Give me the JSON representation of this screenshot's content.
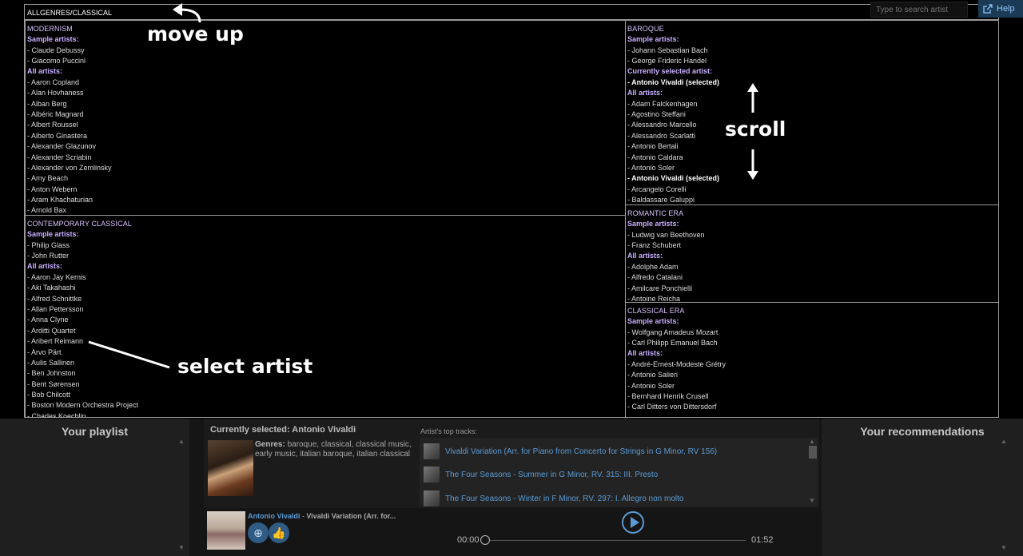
{
  "breadcrumb": "ALLGENRES/CLASSICAL",
  "search": {
    "placeholder": "Type to search artist"
  },
  "help_label": "Help",
  "annotations": {
    "move_up": "move up",
    "scroll": "scroll",
    "select_artist": "select artist"
  },
  "genres": {
    "modernism": {
      "title": "MODERNISM",
      "sample_label": "Sample artists:",
      "sample": [
        "- Claude Debussy",
        "- Giacomo Puccini"
      ],
      "all_label": "All artists:",
      "all": [
        "- Aaron Copland",
        "- Alan Hovhaness",
        "- Alban Berg",
        "- Albéric Magnard",
        "- Albert Roussel",
        "- Alberto Ginastera",
        "- Alexander Glazunov",
        "- Alexander Scriabin",
        "- Alexander von Zemlinsky",
        "- Amy Beach",
        "- Anton Webern",
        "- Aram Khachaturian",
        "- Arnold Bax"
      ]
    },
    "contemporary": {
      "title": "CONTEMPORARY CLASSICAL",
      "sample_label": "Sample artists:",
      "sample": [
        "- Philip Glass",
        "- John Rutter"
      ],
      "all_label": "All artists:",
      "all": [
        "- Aaron Jay Kernis",
        "- Aki Takahashi",
        "- Alfred Schnittke",
        "- Allan Pettersson",
        "- Anna Clyne",
        "- Arditti Quartet",
        "- Aribert Reimann",
        "- Arvo Pärt",
        "- Aulis Sallinen",
        "- Ben Johnston",
        "- Bent Sørensen",
        "- Bob Chilcott",
        "- Boston Modern Orchestra Project",
        "- Charles Koechlin"
      ]
    },
    "baroque": {
      "title": "BAROQUE",
      "sample_label": "Sample artists:",
      "sample": [
        "- Johann Sebastian Bach",
        "- George Frideric Handel"
      ],
      "current_label": "Currently selected artist:",
      "current": "- Antonio Vivaldi (selected)",
      "all_label": "All artists:",
      "all": [
        "- Adam Falckenhagen",
        "- Agostino Steffani",
        "- Alessandro Marcello",
        "- Alessandro Scarlatti",
        "- Antonio Bertali",
        "- Antonio Caldara",
        "- Antonio Soler",
        "- Antonio Vivaldi (selected)",
        "- Arcangelo Corelli",
        "- Baldassare Galuppi"
      ]
    },
    "romantic": {
      "title": "ROMANTIC ERA",
      "sample_label": "Sample artists:",
      "sample": [
        "- Ludwig van Beethoven",
        "- Franz Schubert"
      ],
      "all_label": "All artists:",
      "all": [
        "- Adolphe Adam",
        "- Alfredo Catalani",
        "- Amilcare Ponchielli",
        "- Antoine Reicha"
      ]
    },
    "classical_era": {
      "title": "CLASSICAL ERA",
      "sample_label": "Sample artists:",
      "sample": [
        "- Wolfgang Amadeus Mozart",
        "- Carl Philipp Emanuel Bach"
      ],
      "all_label": "All artists:",
      "all": [
        "- André-Ernest-Modeste Grétry",
        "- Antonio Salieri",
        "- Antonio Soler",
        "- Bernhard Henrik Crusell",
        "- Carl Ditters von Dittersdorf"
      ]
    }
  },
  "playlist": {
    "title": "Your playlist"
  },
  "recommendations": {
    "title": "Your recommendations"
  },
  "selected": {
    "title": "Currently selected: Antonio Vivaldi",
    "genres_label": "Genres:",
    "genres_text": "baroque, classical, classical music, early music, italian baroque, italian classical",
    "top_tracks_label": "Artist's top tracks:",
    "tracks": [
      "Vivaldi Variation (Arr. for Piano from Concerto for Strings in G Minor, RV 156)",
      "The Four Seasons - Summer in G Minor, RV. 315: III. Presto",
      "The Four Seasons - Winter in F Minor, RV. 297: I. Allegro non molto"
    ]
  },
  "player": {
    "artist": "Antonio Vivaldi",
    "separator": " - ",
    "track": "Vivaldi Variation (Arr. for...",
    "time_current": "00:00",
    "time_total": "01:52",
    "progress": 0
  }
}
